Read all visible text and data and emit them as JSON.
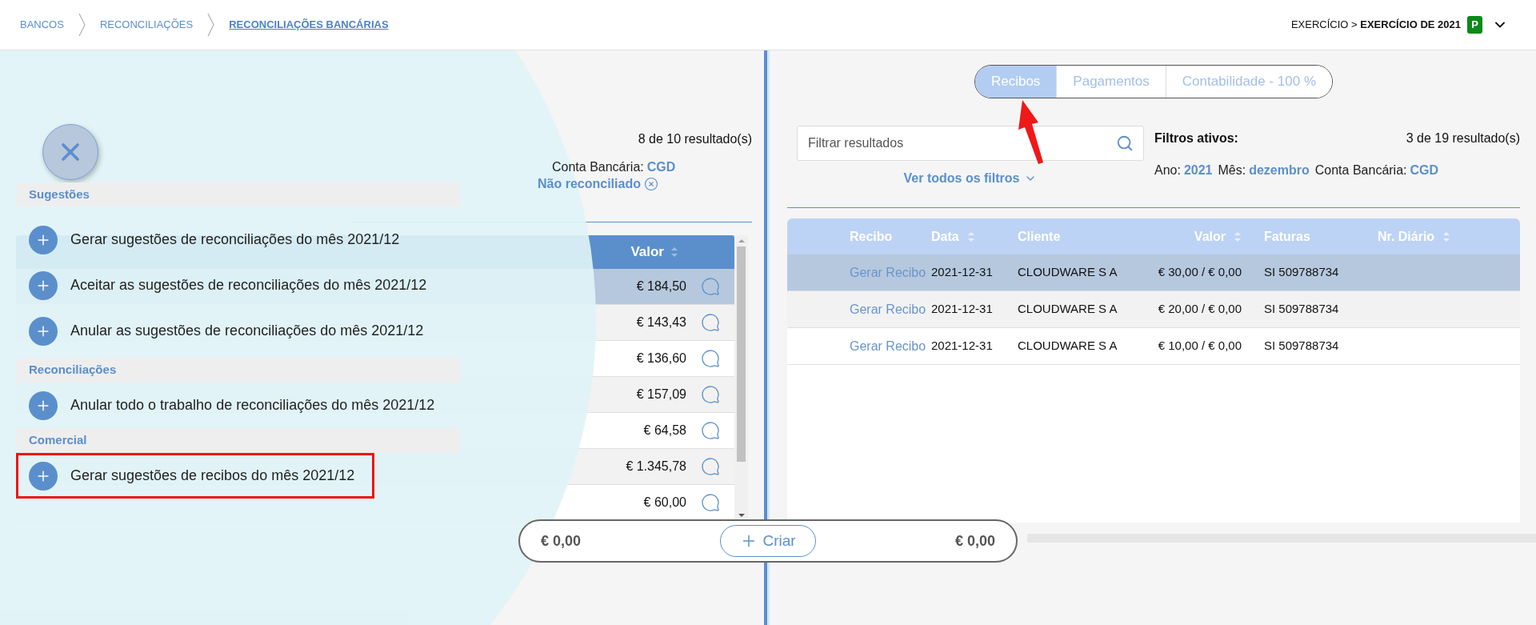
{
  "breadcrumbs": [
    {
      "label": "BANCOS",
      "selected": false
    },
    {
      "label": "RECONCILIAÇÕES",
      "selected": false
    },
    {
      "label": "RECONCILIAÇÕES BANCÁRIAS",
      "selected": true
    }
  ],
  "exercise": {
    "text": "EXERCÍCIO > **EXERCÍCIO DE 2021**",
    "badge": "P"
  },
  "left_panel": {
    "count": "8 de 10 resultado(s)",
    "filters": [
      {
        "label": "Conta Bancária:",
        "value": "CGD",
        "removable": false
      },
      {
        "value": "Não reconciliado",
        "removable": true
      }
    ],
    "table": {
      "value_column": "Valor",
      "rows": [
        {
          "value": "€ 184,50",
          "selected": true
        },
        {
          "value": "€ 143,43",
          "selected": false
        },
        {
          "value": "€ 136,60",
          "selected": false
        },
        {
          "value": "€ 157,09",
          "selected": false
        },
        {
          "value": "€ 64,58",
          "selected": false
        },
        {
          "value": "€ 1.345,78",
          "selected": false
        },
        {
          "value": "€ 60,00",
          "selected": false
        }
      ]
    }
  },
  "menu": {
    "sections": [
      {
        "title": "Sugestões",
        "items": [
          {
            "label": "Gerar sugestões de reconciliações do mês 2021/12",
            "highlighted": false
          },
          {
            "label": "Aceitar as sugestões de reconciliações do mês 2021/12",
            "highlighted": false
          },
          {
            "label": "Anular as sugestões de reconciliações do mês 2021/12",
            "highlighted": false
          }
        ]
      },
      {
        "title": "Reconciliações",
        "items": [
          {
            "label": "Anular todo o trabalho de reconciliações do mês 2021/12",
            "highlighted": false
          }
        ]
      },
      {
        "title": "Comercial",
        "items": [
          {
            "label": "Gerar sugestões de recibos do mês 2021/12",
            "highlighted": true
          }
        ]
      }
    ]
  },
  "right_panel": {
    "tabs": [
      {
        "label": "Recibos",
        "selected": true
      },
      {
        "label": "Pagamentos",
        "selected": false
      },
      {
        "label": "Contabilidade - 100 %",
        "selected": false
      }
    ],
    "search": {
      "placeholder": "Filtrar resultados"
    },
    "see_all_filters": "Ver todos os filtros",
    "active_filters_title": "Filtros ativos:",
    "count": "3 de 19 resultado(s)",
    "filters": [
      {
        "label": "Ano:",
        "value": "2021"
      },
      {
        "label": "Mês:",
        "value": "dezembro"
      },
      {
        "label": "Conta Bancária:",
        "value": "CGD"
      }
    ],
    "table": {
      "columns": [
        {
          "label": "Recibo",
          "sortable": false
        },
        {
          "label": "Data",
          "sortable": true
        },
        {
          "label": "Cliente",
          "sortable": false
        },
        {
          "label": "Valor",
          "sortable": true
        },
        {
          "label": "Faturas",
          "sortable": false
        },
        {
          "label": "Nr. Diário",
          "sortable": true
        }
      ],
      "rows": [
        {
          "selected": true,
          "cells": [
            "Gerar Recibo",
            "2021-12-31",
            "CLOUDWARE S A",
            "€ 30,00 / € 0,00",
            "SI 509788734"
          ]
        },
        {
          "selected": false,
          "cells": [
            "Gerar Recibo",
            "2021-12-31",
            "CLOUDWARE S A",
            "€ 20,00 / € 0,00",
            "SI 509788734"
          ]
        },
        {
          "selected": false,
          "cells": [
            "Gerar Recibo",
            "2021-12-31",
            "CLOUDWARE S A",
            "€ 10,00 / € 0,00",
            "SI 509788734"
          ]
        }
      ]
    }
  },
  "totals": {
    "left": "€ 0,00",
    "create_button": "Criar",
    "right": "€ 0,00"
  }
}
